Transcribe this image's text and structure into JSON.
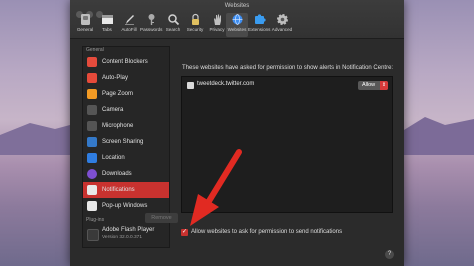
{
  "window": {
    "title": "Websites"
  },
  "toolbar": [
    {
      "label": "General",
      "icon": "switch-icon",
      "color": "#bdbdbd"
    },
    {
      "label": "Tabs",
      "icon": "tabs-icon",
      "color": "#e8e8e8"
    },
    {
      "label": "AutoFill",
      "icon": "pencil-icon",
      "color": "#d9d9d9"
    },
    {
      "label": "Passwords",
      "icon": "key-icon",
      "color": "#aaaaaa"
    },
    {
      "label": "Search",
      "icon": "search-icon",
      "color": "#d0d0d0"
    },
    {
      "label": "Security",
      "icon": "lock-icon",
      "color": "#e0c060"
    },
    {
      "label": "Privacy",
      "icon": "hand-icon",
      "color": "#bfbfbf"
    },
    {
      "label": "Websites",
      "icon": "globe-icon",
      "color": "#3d8df0"
    },
    {
      "label": "Extensions",
      "icon": "puzzle-icon",
      "color": "#3a9cf0"
    },
    {
      "label": "Advanced",
      "icon": "gear-icon",
      "color": "#bdbdbd"
    }
  ],
  "sidebar": {
    "general_header": "General",
    "items": [
      {
        "label": "Content Blockers",
        "icon": "content-blockers-icon",
        "color": "#e54b3c"
      },
      {
        "label": "Auto-Play",
        "icon": "play-icon",
        "color": "#e64a3a"
      },
      {
        "label": "Page Zoom",
        "icon": "zoom-icon",
        "color": "#f29a24"
      },
      {
        "label": "Camera",
        "icon": "camera-icon",
        "color": "#555555"
      },
      {
        "label": "Microphone",
        "icon": "microphone-icon",
        "color": "#555555"
      },
      {
        "label": "Screen Sharing",
        "icon": "screen-sharing-icon",
        "color": "#3479c9"
      },
      {
        "label": "Location",
        "icon": "location-icon",
        "color": "#2f7de1"
      },
      {
        "label": "Downloads",
        "icon": "downloads-icon",
        "color": "#7e4fd1"
      },
      {
        "label": "Notifications",
        "icon": "notifications-icon",
        "color": "#e8e8e8",
        "selected": true
      },
      {
        "label": "Pop-up Windows",
        "icon": "popup-windows-icon",
        "color": "#e8e8e8"
      }
    ],
    "plugins_header": "Plug-ins",
    "plugins": [
      {
        "label": "Adobe Flash Player",
        "version": "Version 32.0.0.371"
      }
    ]
  },
  "main": {
    "description": "These websites have asked for permission to show alerts in Notification Centre:",
    "sites": [
      {
        "domain": "tweetdeck.twitter.com",
        "setting": "Allow"
      }
    ],
    "remove_button": "Remove",
    "allow_checkbox_label": "Allow websites to ask for permission to send notifications",
    "allow_checked": true,
    "help": "?"
  },
  "colors": {
    "accent": "#c8322f",
    "annotation_arrow": "#e12a22"
  }
}
